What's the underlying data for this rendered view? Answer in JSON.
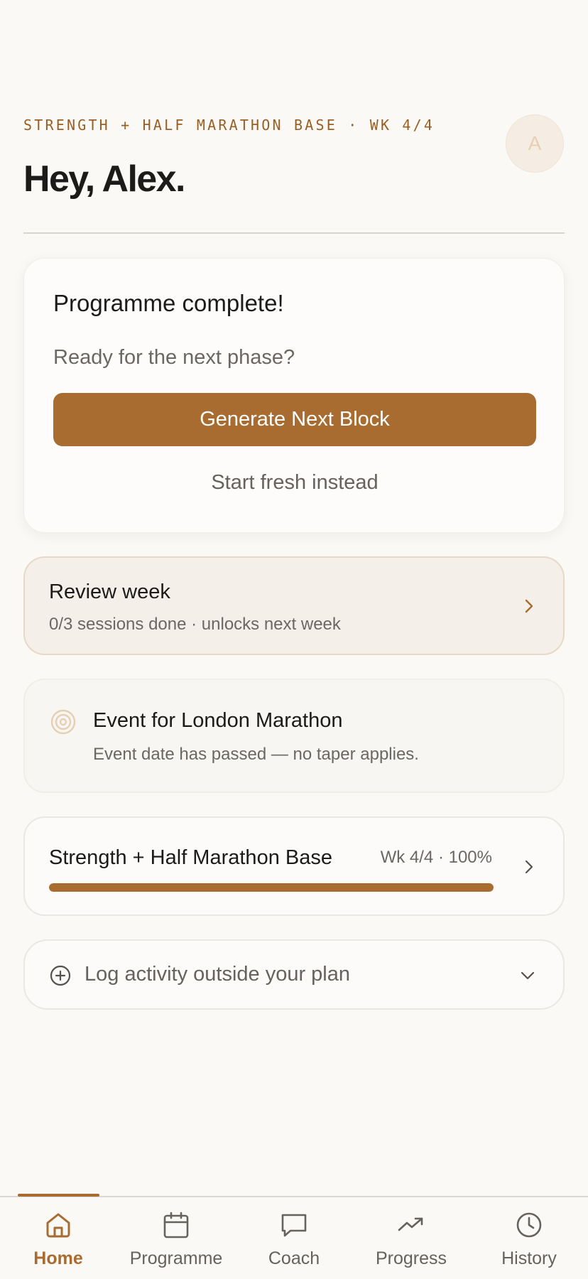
{
  "header": {
    "eyebrow": "STRENGTH + HALF MARATHON BASE · WK 4/4",
    "greeting": "Hey, Alex.",
    "avatar_initial": "A"
  },
  "completion_card": {
    "title": "Programme complete!",
    "subtitle": "Ready for the next phase?",
    "primary_button": "Generate Next Block",
    "secondary_link": "Start fresh instead"
  },
  "review_card": {
    "title": "Review week",
    "subtitle": "0/3 sessions done · unlocks next week"
  },
  "event_card": {
    "title": "Event for London Marathon",
    "subtitle": "Event date has passed — no taper applies.",
    "icon": "target-icon"
  },
  "programme_card": {
    "title": "Strength + Half Marathon Base",
    "meta": "Wk 4/4 · 100%",
    "progress_percent": 100
  },
  "log_card": {
    "label": "Log activity outside your plan",
    "icon": "plus-circle-icon"
  },
  "bottom_nav": {
    "items": [
      {
        "label": "Home",
        "icon": "home-icon",
        "active": true
      },
      {
        "label": "Programme",
        "icon": "calendar-icon",
        "active": false
      },
      {
        "label": "Coach",
        "icon": "chat-icon",
        "active": false
      },
      {
        "label": "Progress",
        "icon": "trend-icon",
        "active": false
      },
      {
        "label": "History",
        "icon": "clock-icon",
        "active": false
      }
    ]
  },
  "colors": {
    "accent": "#a86c30",
    "background": "#faf9f6",
    "text_primary": "#1c1b1a",
    "text_secondary": "#6b6864"
  }
}
